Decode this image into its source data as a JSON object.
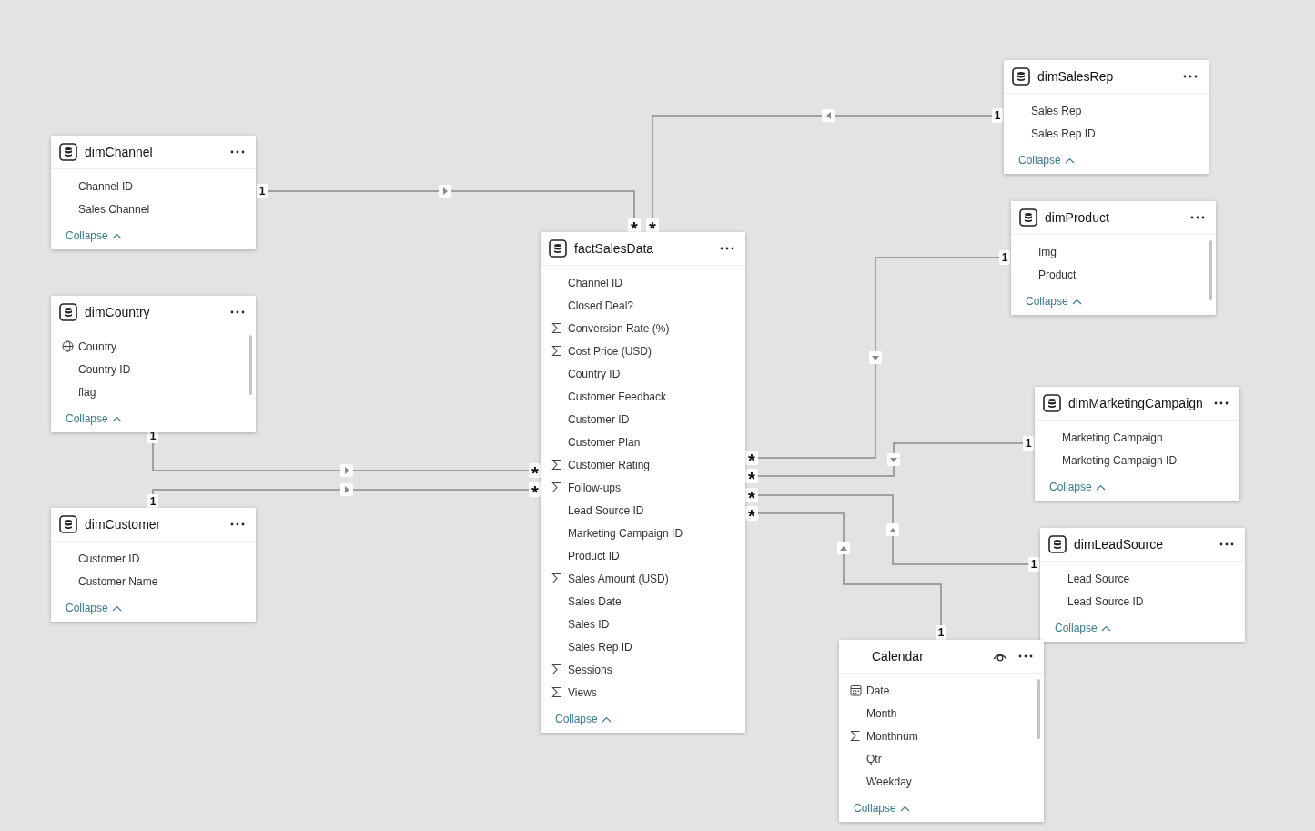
{
  "tables": [
    {
      "name": "dimSalesRep",
      "kind": "table",
      "scrollbar": false,
      "fields": [
        {
          "label": "Sales Rep",
          "kind": "plain"
        },
        {
          "label": "Sales Rep ID",
          "kind": "plain"
        }
      ],
      "collapse": "Collapse"
    },
    {
      "name": "dimChannel",
      "kind": "table",
      "scrollbar": false,
      "fields": [
        {
          "label": "Channel ID",
          "kind": "plain"
        },
        {
          "label": "Sales Channel",
          "kind": "plain"
        }
      ],
      "collapse": "Collapse"
    },
    {
      "name": "dimProduct",
      "kind": "table",
      "scrollbar": true,
      "fields": [
        {
          "label": "Img",
          "kind": "plain"
        },
        {
          "label": "Product",
          "kind": "plain"
        }
      ],
      "collapse": "Collapse"
    },
    {
      "name": "factSalesData",
      "kind": "table",
      "scrollbar": false,
      "fields": [
        {
          "label": "Channel ID",
          "kind": "plain"
        },
        {
          "label": "Closed Deal?",
          "kind": "plain"
        },
        {
          "label": "Conversion Rate (%)",
          "kind": "sum"
        },
        {
          "label": "Cost Price (USD)",
          "kind": "sum"
        },
        {
          "label": "Country ID",
          "kind": "plain"
        },
        {
          "label": "Customer Feedback",
          "kind": "plain"
        },
        {
          "label": "Customer ID",
          "kind": "plain"
        },
        {
          "label": "Customer Plan",
          "kind": "plain"
        },
        {
          "label": "Customer Rating",
          "kind": "sum"
        },
        {
          "label": "Follow-ups",
          "kind": "sum"
        },
        {
          "label": "Lead Source ID",
          "kind": "plain"
        },
        {
          "label": "Marketing Campaign ID",
          "kind": "plain"
        },
        {
          "label": "Product ID",
          "kind": "plain"
        },
        {
          "label": "Sales Amount (USD)",
          "kind": "sum"
        },
        {
          "label": "Sales Date",
          "kind": "plain"
        },
        {
          "label": "Sales ID",
          "kind": "plain"
        },
        {
          "label": "Sales Rep ID",
          "kind": "plain"
        },
        {
          "label": "Sessions",
          "kind": "sum"
        },
        {
          "label": "Views",
          "kind": "sum"
        }
      ],
      "collapse": "Collapse"
    },
    {
      "name": "dimCountry",
      "kind": "table",
      "scrollbar": true,
      "fields": [
        {
          "label": "Country",
          "kind": "globe"
        },
        {
          "label": "Country ID",
          "kind": "plain"
        },
        {
          "label": "flag",
          "kind": "plain"
        }
      ],
      "collapse": "Collapse"
    },
    {
      "name": "dimMarketingCampaign",
      "kind": "table",
      "scrollbar": false,
      "fields": [
        {
          "label": "Marketing Campaign",
          "kind": "plain"
        },
        {
          "label": "Marketing Campaign ID",
          "kind": "plain"
        }
      ],
      "collapse": "Collapse"
    },
    {
      "name": "dimCustomer",
      "kind": "table",
      "scrollbar": false,
      "fields": [
        {
          "label": "Customer ID",
          "kind": "plain"
        },
        {
          "label": "Customer Name",
          "kind": "plain"
        }
      ],
      "collapse": "Collapse"
    },
    {
      "name": "dimLeadSource",
      "kind": "table",
      "scrollbar": false,
      "fields": [
        {
          "label": "Lead Source",
          "kind": "plain"
        },
        {
          "label": "Lead Source ID",
          "kind": "plain"
        }
      ],
      "collapse": "Collapse"
    },
    {
      "name": "Calendar",
      "kind": "date",
      "scrollbar": true,
      "fields": [
        {
          "label": "Date",
          "kind": "calendar"
        },
        {
          "label": "Month",
          "kind": "plain"
        },
        {
          "label": "Monthnum",
          "kind": "sum"
        },
        {
          "label": "Qtr",
          "kind": "plain"
        },
        {
          "label": "Weekday",
          "kind": "plain"
        }
      ],
      "collapse": "Collapse"
    }
  ],
  "relationships": [
    {
      "one": "1",
      "many": "*"
    },
    {
      "one": "1",
      "many": "*"
    },
    {
      "one": "1",
      "many": "*"
    },
    {
      "one": "1",
      "many": "*"
    },
    {
      "one": "1",
      "many": "*"
    },
    {
      "one": "1",
      "many": "*"
    },
    {
      "one": "1",
      "many": "*"
    },
    {
      "one": "1",
      "many": "*"
    }
  ]
}
